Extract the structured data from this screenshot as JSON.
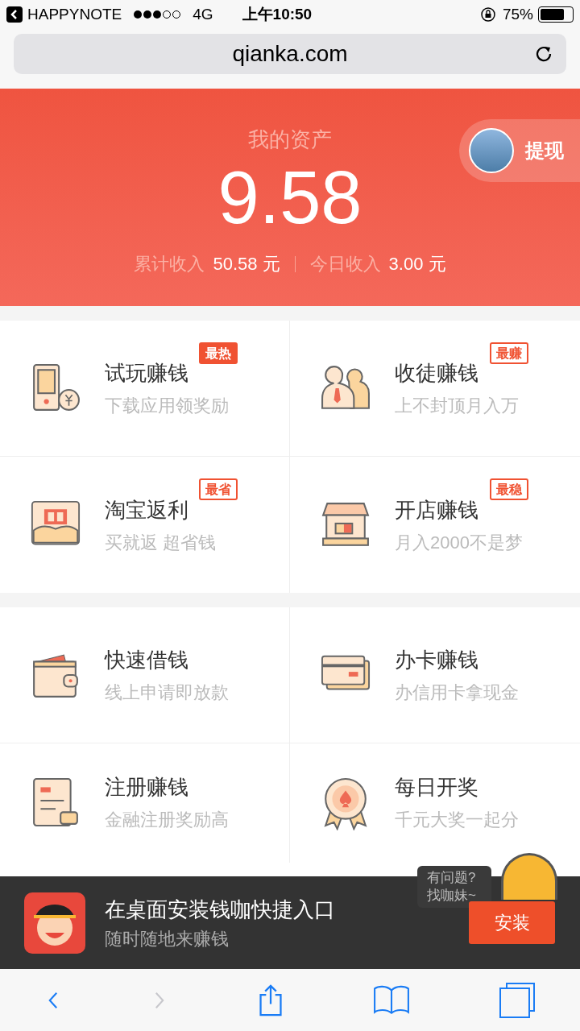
{
  "status_bar": {
    "back_app": "HAPPYNOTE",
    "network": "4G",
    "time": "上午10:50",
    "battery": "75%"
  },
  "address_bar": {
    "url": "qianka.com"
  },
  "assets": {
    "title": "我的资产",
    "amount": "9.58",
    "withdraw": "提现",
    "stats": [
      {
        "label": "累计收入",
        "value": "50.58 元"
      },
      {
        "label": "今日收入",
        "value": "3.00 元"
      }
    ]
  },
  "sections": [
    {
      "items": [
        {
          "title": "试玩赚钱",
          "subtitle": "下载应用领奖励",
          "badge": {
            "text": "最热",
            "kind": "filled"
          }
        },
        {
          "title": "收徒赚钱",
          "subtitle": "上不封顶月入万",
          "badge": {
            "text": "最赚",
            "kind": "outline"
          }
        },
        {
          "title": "淘宝返利",
          "subtitle": "买就返 超省钱",
          "badge": {
            "text": "最省",
            "kind": "outline"
          }
        },
        {
          "title": "开店赚钱",
          "subtitle": "月入2000不是梦",
          "badge": {
            "text": "最稳",
            "kind": "outline"
          }
        }
      ]
    },
    {
      "items": [
        {
          "title": "快速借钱",
          "subtitle": "线上申请即放款"
        },
        {
          "title": "办卡赚钱",
          "subtitle": "办信用卡拿现金"
        },
        {
          "title": "注册赚钱",
          "subtitle": "金融注册奖励高"
        },
        {
          "title": "每日开奖",
          "subtitle": "千元大奖一起分"
        }
      ]
    }
  ],
  "chat_bubble": {
    "lines": [
      "有问题?",
      "找咖妹~"
    ]
  },
  "install_banner": {
    "title": "在桌面安装钱咖快捷入口",
    "subtitle": "随时随地来赚钱",
    "button": "安装"
  },
  "toolbar": [
    {
      "kind": "back",
      "disabled": false
    },
    {
      "kind": "forward",
      "disabled": true
    },
    {
      "kind": "share",
      "disabled": false
    },
    {
      "kind": "bookmarks",
      "disabled": false
    },
    {
      "kind": "tabs",
      "disabled": false
    }
  ]
}
